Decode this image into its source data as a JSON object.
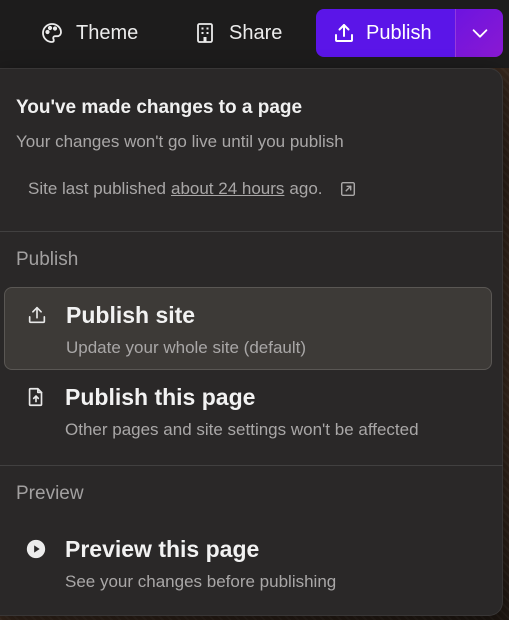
{
  "topbar": {
    "theme_label": "Theme",
    "share_label": "Share",
    "publish_label": "Publish"
  },
  "notice": {
    "title": "You've made changes to a page",
    "subtitle": "Your changes won't go live until you publish",
    "last_published_prefix": "Site last published",
    "last_published_link": "about 24 hours",
    "last_published_suffix": "ago."
  },
  "publish_section": {
    "label": "Publish",
    "options": [
      {
        "title": "Publish site",
        "desc": "Update your whole site (default)"
      },
      {
        "title": "Publish this page",
        "desc": "Other pages and site settings won't be affected"
      }
    ]
  },
  "preview_section": {
    "label": "Preview",
    "options": [
      {
        "title": "Preview this page",
        "desc": "See your changes before publishing"
      }
    ]
  },
  "colors": {
    "accent": "#5b15e8",
    "accent_gradient_end": "#8a19d2",
    "panel_bg": "#2a2828",
    "selected_bg": "#3d3a37"
  }
}
